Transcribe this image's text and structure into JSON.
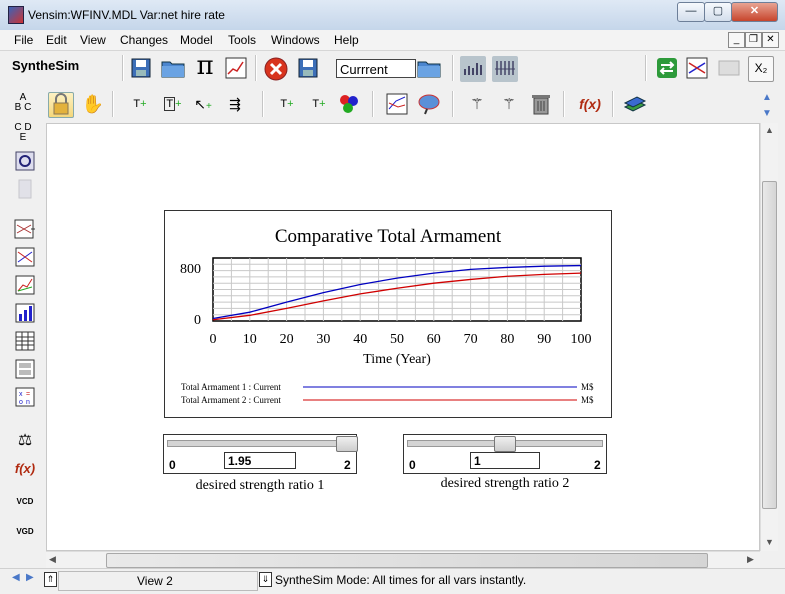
{
  "window": {
    "title": "Vensim:WFINV.MDL Var:net hire rate",
    "min": "—",
    "max": "▢",
    "close": "✕"
  },
  "menu": {
    "items": [
      "File",
      "Edit",
      "View",
      "Changes",
      "Model",
      "Tools",
      "Windows",
      "Help"
    ]
  },
  "toolbar": {
    "mode_label": "SyntheSim",
    "run_name": "Currrent",
    "pi_symbol": "π",
    "fx_label": "f(x)",
    "x2_label": "X₂"
  },
  "sidebar": {
    "fx_label": "f(x)",
    "vcd_label": "VCD",
    "vgd_label": "VGD"
  },
  "graph": {
    "title": "Comparative Total Armament",
    "xlabel": "Time (Year)",
    "ytick_top": "800",
    "ytick_bottom": "0",
    "legend": [
      {
        "label": "Total Armament 1 : Current",
        "unit": "M$",
        "color": "#0000c0"
      },
      {
        "label": "Total Armament 2 : Current",
        "unit": "M$",
        "color": "#d00000"
      }
    ]
  },
  "chart_data": {
    "type": "line",
    "title": "Comparative Total Armament",
    "xlabel": "Time (Year)",
    "ylabel": "",
    "xlim": [
      0,
      100
    ],
    "ylim": [
      0,
      1000
    ],
    "xticks": [
      0,
      10,
      20,
      30,
      40,
      50,
      60,
      70,
      80,
      90,
      100
    ],
    "yticks": [
      0,
      800
    ],
    "x": [
      0,
      10,
      20,
      30,
      40,
      50,
      60,
      70,
      80,
      90,
      100
    ],
    "series": [
      {
        "name": "Total Armament 1 : Current",
        "values": [
          40,
          140,
          300,
          450,
          580,
          680,
          760,
          820,
          850,
          870,
          880
        ]
      },
      {
        "name": "Total Armament 2 : Current",
        "values": [
          20,
          90,
          200,
          320,
          430,
          520,
          600,
          660,
          710,
          740,
          760
        ]
      }
    ]
  },
  "sliders": [
    {
      "name": "desired strength ratio 1",
      "value": "1.95",
      "min": "0",
      "max": "2",
      "fraction": 0.975
    },
    {
      "name": "desired strength ratio 2",
      "value": "1",
      "min": "0",
      "max": "2",
      "fraction": 0.5
    }
  ],
  "status": {
    "view": "View 2",
    "mode_text": "SyntheSim Mode: All times for all vars instantly."
  }
}
